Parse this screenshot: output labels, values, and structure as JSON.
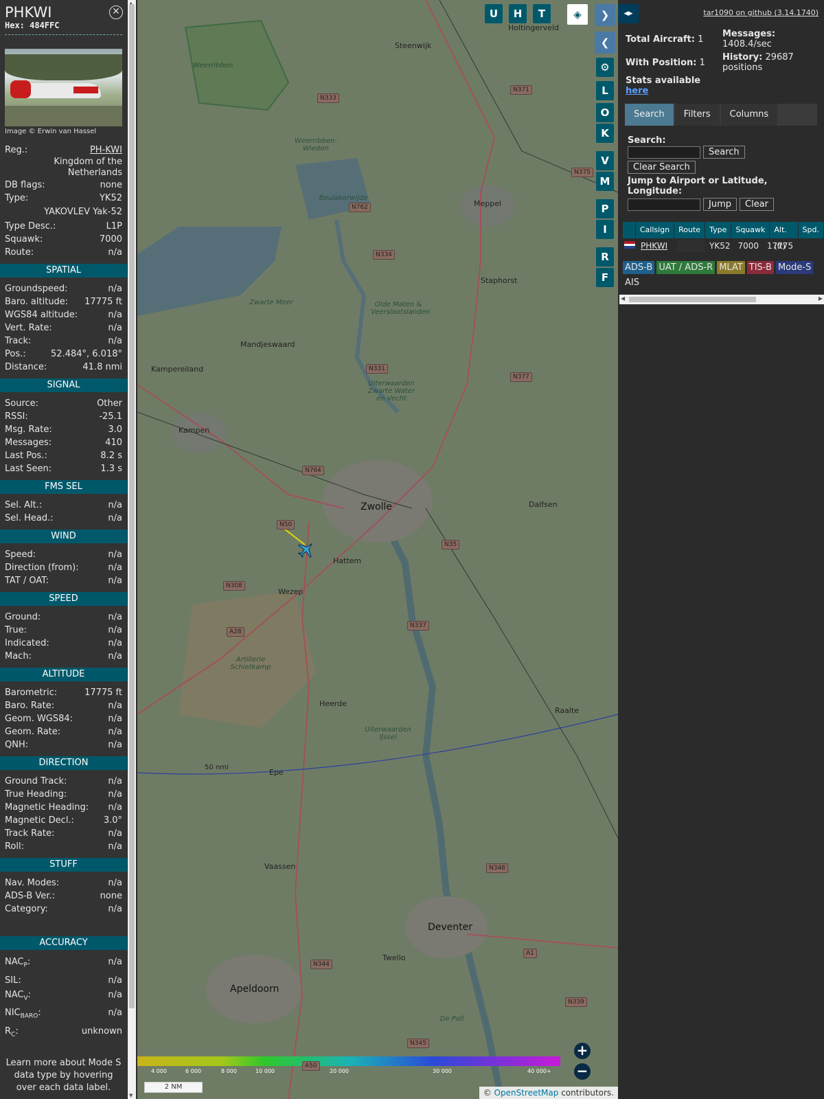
{
  "aircraft": {
    "callsign": "PHKWI",
    "hex": "Hex: 484FFC",
    "image_credit": "Image © Erwin van Hassel",
    "reg_label": "Reg.:",
    "reg": "PH-KWI",
    "country": "Kingdom of the Netherlands",
    "db_flags_label": "DB flags:",
    "db_flags": "none",
    "type_label": "Type:",
    "type": "YK52",
    "type_full": "YAKOVLEV Yak-52",
    "type_desc_label": "Type Desc.:",
    "type_desc": "L1P",
    "squawk_label": "Squawk:",
    "squawk": "7000",
    "route_label": "Route:",
    "route": "n/a"
  },
  "sections": {
    "spatial": "SPATIAL",
    "signal": "SIGNAL",
    "fms": "FMS SEL",
    "wind": "WIND",
    "speed": "SPEED",
    "altitude": "ALTITUDE",
    "direction": "DIRECTION",
    "stuff": "STUFF",
    "accuracy": "ACCURACY"
  },
  "spatial": [
    {
      "label": "Groundspeed:",
      "value": "n/a"
    },
    {
      "label": "Baro. altitude:",
      "value": "17775 ft"
    },
    {
      "label": "WGS84 altitude:",
      "value": "n/a"
    },
    {
      "label": "Vert. Rate:",
      "value": "n/a"
    },
    {
      "label": "Track:",
      "value": "n/a"
    },
    {
      "label": "Pos.:",
      "value": "52.484°, 6.018°"
    },
    {
      "label": "Distance:",
      "value": "41.8 nmi"
    }
  ],
  "signal": [
    {
      "label": "Source:",
      "value": "Other"
    },
    {
      "label": "RSSI:",
      "value": "-25.1"
    },
    {
      "label": "Msg. Rate:",
      "value": "3.0"
    },
    {
      "label": "Messages:",
      "value": "410"
    },
    {
      "label": "Last Pos.:",
      "value": "8.2 s"
    },
    {
      "label": "Last Seen:",
      "value": "1.3 s"
    }
  ],
  "fms": [
    {
      "label": "Sel. Alt.:",
      "value": "n/a"
    },
    {
      "label": "Sel. Head.:",
      "value": "n/a"
    }
  ],
  "wind": [
    {
      "label": "Speed:",
      "value": "n/a"
    },
    {
      "label": "Direction (from):",
      "value": "n/a"
    },
    {
      "label": "TAT / OAT:",
      "value": "n/a"
    }
  ],
  "speed": [
    {
      "label": "Ground:",
      "value": "n/a"
    },
    {
      "label": "True:",
      "value": "n/a"
    },
    {
      "label": "Indicated:",
      "value": "n/a"
    },
    {
      "label": "Mach:",
      "value": "n/a"
    }
  ],
  "altitude": [
    {
      "label": "Barometric:",
      "value": "17775 ft"
    },
    {
      "label": "Baro. Rate:",
      "value": "n/a"
    },
    {
      "label": "Geom. WGS84:",
      "value": "n/a"
    },
    {
      "label": "Geom. Rate:",
      "value": "n/a"
    },
    {
      "label": "QNH:",
      "value": "n/a"
    }
  ],
  "direction": [
    {
      "label": "Ground Track:",
      "value": "n/a"
    },
    {
      "label": "True Heading:",
      "value": "n/a"
    },
    {
      "label": "Magnetic Heading:",
      "value": "n/a"
    },
    {
      "label": "Magnetic Decl.:",
      "value": "3.0°"
    },
    {
      "label": "Track Rate:",
      "value": "n/a"
    },
    {
      "label": "Roll:",
      "value": "n/a"
    }
  ],
  "stuff": [
    {
      "label": "Nav. Modes:",
      "value": "n/a"
    },
    {
      "label": "ADS-B Ver.:",
      "value": "none"
    },
    {
      "label": "Category:",
      "value": "n/a"
    }
  ],
  "accuracy": [
    {
      "label": "NAC",
      "sub": "P",
      "value": "n/a"
    },
    {
      "label": "SIL",
      "sub": "",
      "value": "n/a"
    },
    {
      "label": "NAC",
      "sub": "V",
      "value": "n/a"
    },
    {
      "label": "NIC",
      "sub": "BARO",
      "value": "n/a"
    },
    {
      "label": "R",
      "sub": "C",
      "value": "unknown"
    }
  ],
  "footer_note": "Learn more about Mode S data type by hovering over each data label.",
  "map": {
    "top_buttons": [
      "U",
      "H",
      "T"
    ],
    "side_buttons": [
      "L",
      "O",
      "K",
      "V",
      "M",
      "P",
      "I",
      "R",
      "F"
    ],
    "range_ring_label": "50 nmi",
    "scale": "2 NM",
    "alt_ticks": [
      "4 000",
      "6 000",
      "8 000",
      "10 000",
      "20 000",
      "30 000",
      "40 000+"
    ],
    "osm_prefix": "© ",
    "osm_link": "OpenStreetMap",
    "osm_suffix": " contributors.",
    "cities": [
      {
        "name": "Steenwijk",
        "cls": ""
      },
      {
        "name": "Meppel",
        "cls": ""
      },
      {
        "name": "Staphorst",
        "cls": ""
      },
      {
        "name": "Zwolle",
        "cls": "city"
      },
      {
        "name": "Kampen",
        "cls": ""
      },
      {
        "name": "Hattem",
        "cls": ""
      },
      {
        "name": "Wezep",
        "cls": ""
      },
      {
        "name": "Dalfsen",
        "cls": ""
      },
      {
        "name": "Heerde",
        "cls": ""
      },
      {
        "name": "Raalte",
        "cls": ""
      },
      {
        "name": "Epe",
        "cls": ""
      },
      {
        "name": "Vaassen",
        "cls": ""
      },
      {
        "name": "Deventer",
        "cls": "city"
      },
      {
        "name": "Twello",
        "cls": ""
      },
      {
        "name": "Apeldoorn",
        "cls": "city"
      },
      {
        "name": "Kampereiland",
        "cls": ""
      },
      {
        "name": "Mandjeswaard",
        "cls": ""
      },
      {
        "name": "Holtingerveld",
        "cls": ""
      }
    ],
    "areas": [
      "Weerribben",
      "Weerribben-Wieden",
      "Beulakerwijde",
      "Zwarte Meer",
      "Olde Maten & Veerslootslanden",
      "Uiterwaarden Zwarte Water en Vecht",
      "Artillerie Schietkamp",
      "Uiterwaarden IJssel",
      "De Poll"
    ],
    "roads": [
      "N333",
      "N371",
      "N375",
      "N762",
      "N334",
      "N331",
      "N377",
      "N764",
      "N50",
      "N35",
      "N308",
      "N337",
      "A28",
      "N348",
      "N344",
      "A1",
      "N339",
      "N345",
      "A50"
    ]
  },
  "right": {
    "github": "tar1090 on github (3.14.1740)",
    "total_label": "Total Aircraft:",
    "total": "1",
    "position_label": "With Position:",
    "position": "1",
    "messages_label": "Messages:",
    "messages": "1408.4/sec",
    "history_label": "History:",
    "history": "29687 positions",
    "stats_text": "Stats available",
    "stats_link": "here",
    "tabs": [
      "Search",
      "Filters",
      "Columns"
    ],
    "search_label": "Search:",
    "search_btn": "Search",
    "clear_search_btn": "Clear Search",
    "jump_label": "Jump to Airport or Latitude, Longitude:",
    "jump_btn": "Jump",
    "clear_btn": "Clear",
    "columns": [
      "Callsign",
      "Route",
      "Type",
      "Squawk",
      "Alt. (ft)",
      "Spd."
    ],
    "row": {
      "callsign": "PHKWI",
      "route": "",
      "type": "YK52",
      "squawk": "7000",
      "alt": "17775"
    },
    "badges": [
      {
        "text": "ADS-B",
        "color": "#1f5f8b"
      },
      {
        "text": "UAT / ADS-R",
        "color": "#2e7a3a"
      },
      {
        "text": "MLAT",
        "color": "#8a7a2a"
      },
      {
        "text": "TIS-B",
        "color": "#8a2a3a"
      },
      {
        "text": "Mode-S",
        "color": "#2a3a7a"
      },
      {
        "text": "AIS",
        "color": ""
      }
    ]
  }
}
